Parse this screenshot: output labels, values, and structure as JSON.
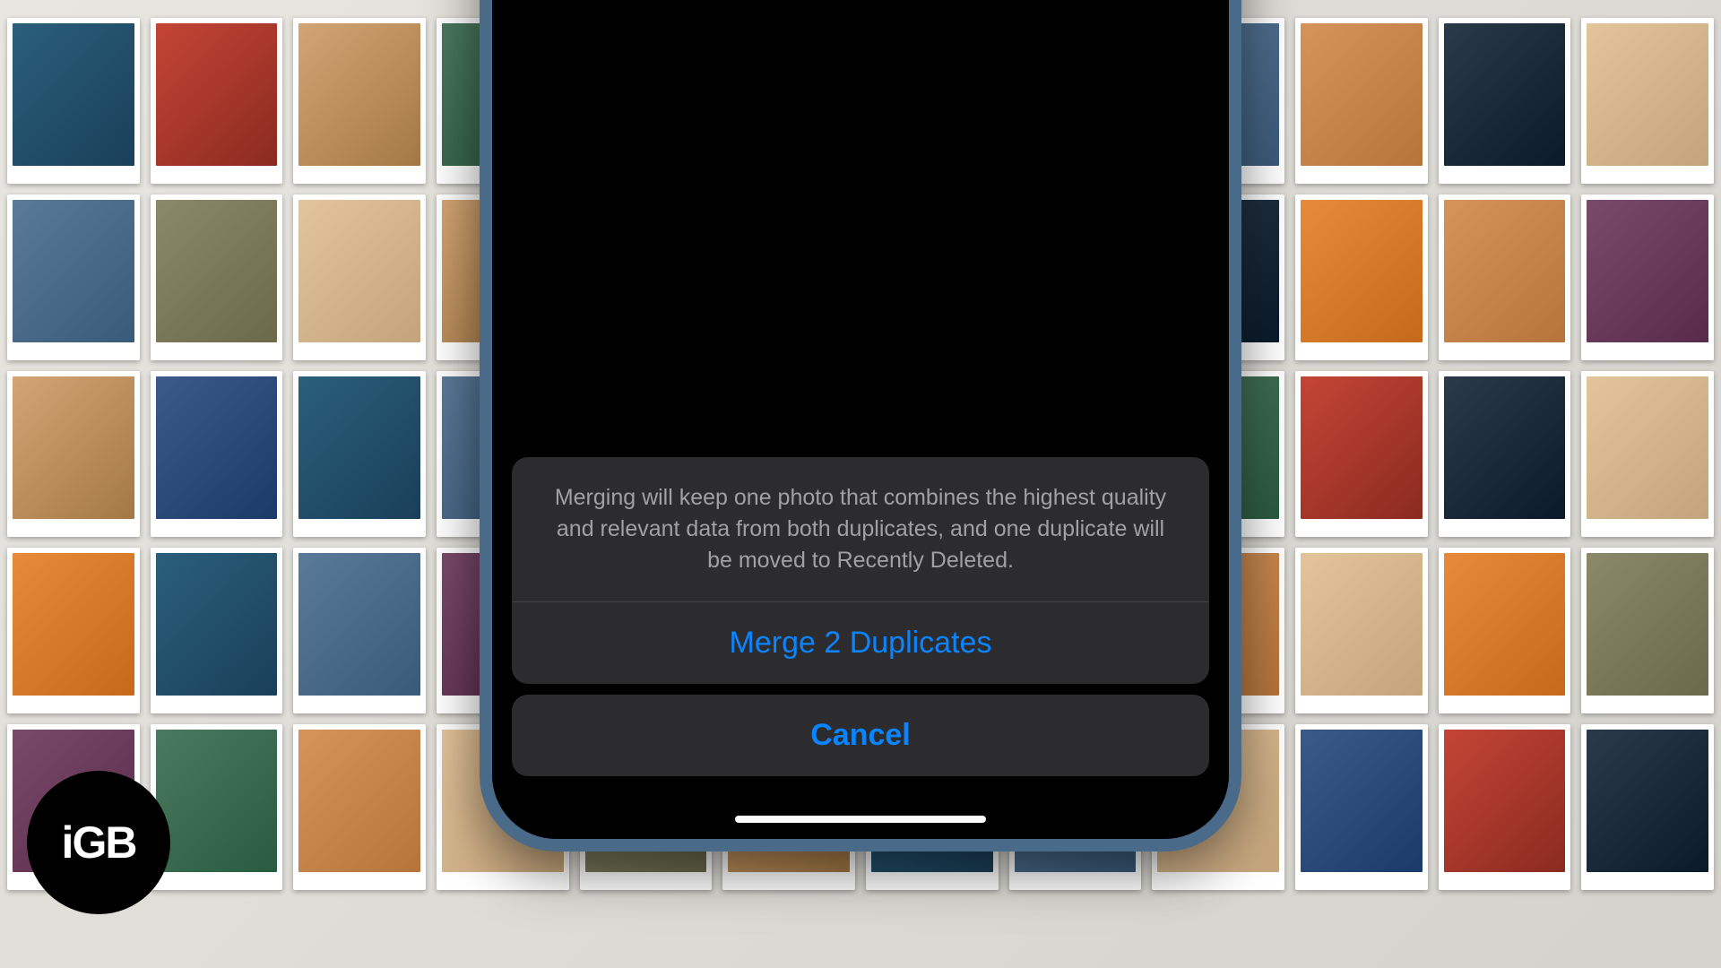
{
  "dialog": {
    "description": "Merging will keep one photo that combines the highest quality and relevant data from both duplicates, and one duplicate will be moved to Recently Deleted.",
    "primary_action": "Merge 2 Duplicates",
    "cancel_action": "Cancel"
  },
  "watermark": {
    "text": "iGB"
  }
}
